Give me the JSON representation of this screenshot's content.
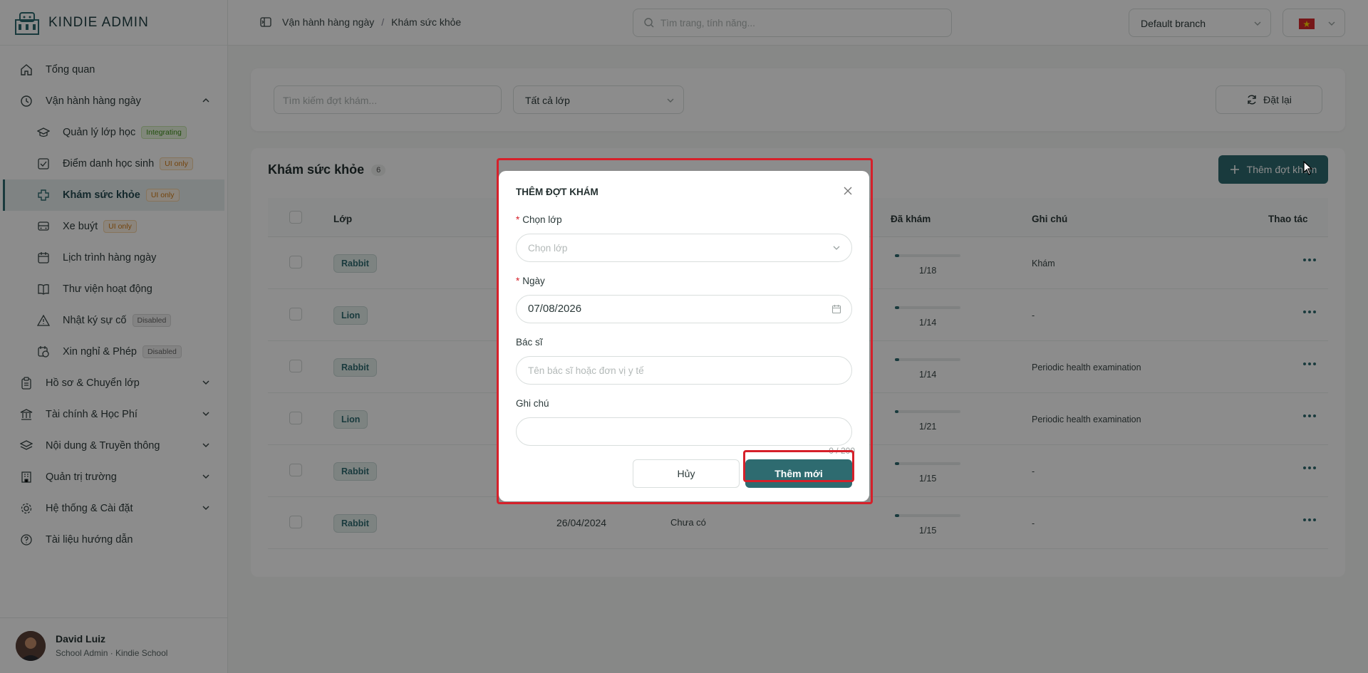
{
  "brand": {
    "name": "KINDIE ADMIN"
  },
  "sidebar": {
    "items": [
      {
        "label": "Tổng quan",
        "icon": "home-icon"
      },
      {
        "label": "Vận hành hàng ngày",
        "icon": "clock-icon",
        "expanded": true
      },
      {
        "label": "Quản lý lớp học",
        "icon": "graduation-cap-icon",
        "badge": "Integrating"
      },
      {
        "label": "Điểm danh học sinh",
        "icon": "checkbox-icon",
        "badge": "UI only"
      },
      {
        "label": "Khám sức khỏe",
        "icon": "health-cross-icon",
        "badge": "UI only",
        "active": true
      },
      {
        "label": "Xe buýt",
        "icon": "bus-icon",
        "badge": "UI only"
      },
      {
        "label": "Lịch trình hàng ngày",
        "icon": "calendar-icon"
      },
      {
        "label": "Thư viện hoạt động",
        "icon": "book-icon"
      },
      {
        "label": "Nhật ký sự cố",
        "icon": "warning-icon",
        "badge": "Disabled"
      },
      {
        "label": "Xin nghỉ & Phép",
        "icon": "calendar-clock-icon",
        "badge": "Disabled"
      },
      {
        "label": "Hồ sơ & Chuyển lớp",
        "icon": "clipboard-icon"
      },
      {
        "label": "Tài chính & Học Phí",
        "icon": "bank-icon"
      },
      {
        "label": "Nội dung & Truyền thông",
        "icon": "layers-icon"
      },
      {
        "label": "Quản trị trường",
        "icon": "building-icon"
      },
      {
        "label": "Hệ thống & Cài đặt",
        "icon": "gear-icon"
      },
      {
        "label": "Tài liệu hướng dẫn",
        "icon": "help-circle-icon"
      }
    ]
  },
  "user": {
    "name": "David Luiz",
    "role": "School Admin · Kindie School"
  },
  "topbar": {
    "breadcrumb": [
      "Vận hành hàng ngày",
      "Khám sức khỏe"
    ],
    "search_placeholder": "Tìm trang, tính năng...",
    "branch": "Default branch",
    "language_flag": "vn"
  },
  "filters": {
    "search_placeholder": "Tìm kiếm đợt khám...",
    "class_select": "Tất cả lớp",
    "reset_label": "Đặt lại"
  },
  "list": {
    "title": "Khám sức khỏe",
    "count": "6",
    "add_label": "Thêm đợt khám",
    "columns": {
      "class": "Lớp",
      "examined": "Đã khám",
      "note": "Ghi chú",
      "actions": "Thao tác"
    },
    "rows": [
      {
        "class": "Rabbit",
        "examined": "1/18",
        "progress": 0.06,
        "note": "Khám"
      },
      {
        "class": "Lion",
        "examined": "1/14",
        "progress": 0.07,
        "note": "-"
      },
      {
        "class": "Rabbit",
        "examined": "1/14",
        "progress": 0.07,
        "note": "Periodic health examination"
      },
      {
        "class": "Lion",
        "examined": "1/21",
        "progress": 0.05,
        "note": "Periodic health examination"
      },
      {
        "class": "Rabbit",
        "examined": "1/15",
        "progress": 0.07,
        "note": "-"
      },
      {
        "class": "Rabbit",
        "date": "26/04/2024",
        "doctor": "Chưa có",
        "examined": "1/15",
        "progress": 0.07,
        "note": "-"
      }
    ]
  },
  "modal": {
    "title": "THÊM ĐỢT KHÁM",
    "class_label": "Chọn lớp",
    "class_placeholder": "Chọn lớp",
    "date_label": "Ngày",
    "date_value": "07/08/2026",
    "doctor_label": "Bác sĩ",
    "doctor_placeholder": "Tên bác sĩ hoặc đơn vị y tế",
    "note_label": "Ghi chú",
    "note_counter": "0 / 200",
    "cancel_label": "Hủy",
    "submit_label": "Thêm mới"
  },
  "colors": {
    "accent": "#2e6b70",
    "highlight": "#d6202a"
  }
}
